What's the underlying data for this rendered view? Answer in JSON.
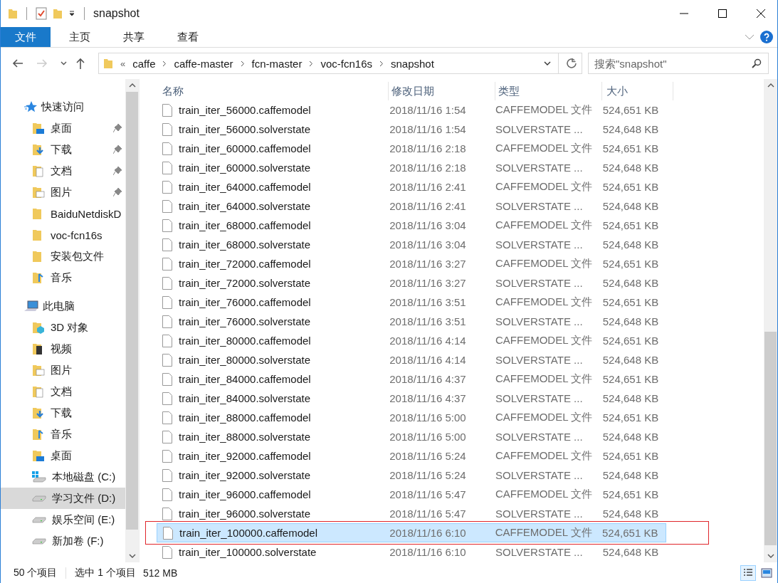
{
  "window": {
    "title": "snapshot"
  },
  "ribbon_tabs": [
    {
      "label": "文件",
      "selected": true
    },
    {
      "label": "主页",
      "selected": false
    },
    {
      "label": "共享",
      "selected": false
    },
    {
      "label": "查看",
      "selected": false
    }
  ],
  "address": {
    "overflow": "«",
    "path": [
      "caffe",
      "caffe-master",
      "fcn-master",
      "voc-fcn16s",
      "snapshot"
    ]
  },
  "search": {
    "placeholder": "搜索\"snapshot\""
  },
  "sidebar": {
    "items": [
      {
        "label": "快速访问",
        "kind": "star",
        "selected": false,
        "children": [
          {
            "label": "桌面",
            "kind": "desktop",
            "pinned": true,
            "selected": false
          },
          {
            "label": "下载",
            "kind": "download",
            "pinned": true,
            "selected": false
          },
          {
            "label": "文档",
            "kind": "documents",
            "pinned": true,
            "selected": false
          },
          {
            "label": "图片",
            "kind": "pictures",
            "pinned": true,
            "selected": false
          },
          {
            "label": "BaiduNetdiskD",
            "kind": "folder",
            "pinned": false,
            "selected": false
          },
          {
            "label": "voc-fcn16s",
            "kind": "folder",
            "pinned": false,
            "selected": false
          },
          {
            "label": "安装包文件",
            "kind": "folder",
            "pinned": false,
            "selected": false
          },
          {
            "label": "音乐",
            "kind": "music",
            "pinned": false,
            "selected": false
          }
        ]
      },
      {
        "label": "此电脑",
        "kind": "computer",
        "selected": false,
        "children": [
          {
            "label": "3D 对象",
            "kind": "objects3d",
            "pinned": false,
            "selected": false
          },
          {
            "label": "视频",
            "kind": "video",
            "pinned": false,
            "selected": false
          },
          {
            "label": "图片",
            "kind": "pictures",
            "pinned": false,
            "selected": false
          },
          {
            "label": "文档",
            "kind": "documents",
            "pinned": false,
            "selected": false
          },
          {
            "label": "下载",
            "kind": "download",
            "pinned": false,
            "selected": false
          },
          {
            "label": "音乐",
            "kind": "music",
            "pinned": false,
            "selected": false
          },
          {
            "label": "桌面",
            "kind": "desktop",
            "pinned": false,
            "selected": false
          },
          {
            "label": "本地磁盘 (C:)",
            "kind": "system-drive",
            "pinned": false,
            "selected": false
          },
          {
            "label": "学习文件 (D:)",
            "kind": "drive",
            "pinned": false,
            "selected": true
          },
          {
            "label": "娱乐空间 (E:)",
            "kind": "drive",
            "pinned": false,
            "selected": false
          },
          {
            "label": "新加卷 (F:)",
            "kind": "drive",
            "pinned": false,
            "selected": false
          }
        ]
      }
    ]
  },
  "table": {
    "columns": [
      "名称",
      "修改日期",
      "类型",
      "大小"
    ],
    "rows": [
      {
        "name": "train_iter_56000.caffemodel",
        "date": "2018/11/16 1:54",
        "type": "CAFFEMODEL 文件",
        "size": "524,651 KB",
        "selected": false,
        "boxed": false
      },
      {
        "name": "train_iter_56000.solverstate",
        "date": "2018/11/16 1:54",
        "type": "SOLVERSTATE ...",
        "size": "524,648 KB",
        "selected": false,
        "boxed": false
      },
      {
        "name": "train_iter_60000.caffemodel",
        "date": "2018/11/16 2:18",
        "type": "CAFFEMODEL 文件",
        "size": "524,651 KB",
        "selected": false,
        "boxed": false
      },
      {
        "name": "train_iter_60000.solverstate",
        "date": "2018/11/16 2:18",
        "type": "SOLVERSTATE ...",
        "size": "524,648 KB",
        "selected": false,
        "boxed": false
      },
      {
        "name": "train_iter_64000.caffemodel",
        "date": "2018/11/16 2:41",
        "type": "CAFFEMODEL 文件",
        "size": "524,651 KB",
        "selected": false,
        "boxed": false
      },
      {
        "name": "train_iter_64000.solverstate",
        "date": "2018/11/16 2:41",
        "type": "SOLVERSTATE ...",
        "size": "524,648 KB",
        "selected": false,
        "boxed": false
      },
      {
        "name": "train_iter_68000.caffemodel",
        "date": "2018/11/16 3:04",
        "type": "CAFFEMODEL 文件",
        "size": "524,651 KB",
        "selected": false,
        "boxed": false
      },
      {
        "name": "train_iter_68000.solverstate",
        "date": "2018/11/16 3:04",
        "type": "SOLVERSTATE ...",
        "size": "524,648 KB",
        "selected": false,
        "boxed": false
      },
      {
        "name": "train_iter_72000.caffemodel",
        "date": "2018/11/16 3:27",
        "type": "CAFFEMODEL 文件",
        "size": "524,651 KB",
        "selected": false,
        "boxed": false
      },
      {
        "name": "train_iter_72000.solverstate",
        "date": "2018/11/16 3:27",
        "type": "SOLVERSTATE ...",
        "size": "524,648 KB",
        "selected": false,
        "boxed": false
      },
      {
        "name": "train_iter_76000.caffemodel",
        "date": "2018/11/16 3:51",
        "type": "CAFFEMODEL 文件",
        "size": "524,651 KB",
        "selected": false,
        "boxed": false
      },
      {
        "name": "train_iter_76000.solverstate",
        "date": "2018/11/16 3:51",
        "type": "SOLVERSTATE ...",
        "size": "524,648 KB",
        "selected": false,
        "boxed": false
      },
      {
        "name": "train_iter_80000.caffemodel",
        "date": "2018/11/16 4:14",
        "type": "CAFFEMODEL 文件",
        "size": "524,651 KB",
        "selected": false,
        "boxed": false
      },
      {
        "name": "train_iter_80000.solverstate",
        "date": "2018/11/16 4:14",
        "type": "SOLVERSTATE ...",
        "size": "524,648 KB",
        "selected": false,
        "boxed": false
      },
      {
        "name": "train_iter_84000.caffemodel",
        "date": "2018/11/16 4:37",
        "type": "CAFFEMODEL 文件",
        "size": "524,651 KB",
        "selected": false,
        "boxed": false
      },
      {
        "name": "train_iter_84000.solverstate",
        "date": "2018/11/16 4:37",
        "type": "SOLVERSTATE ...",
        "size": "524,648 KB",
        "selected": false,
        "boxed": false
      },
      {
        "name": "train_iter_88000.caffemodel",
        "date": "2018/11/16 5:00",
        "type": "CAFFEMODEL 文件",
        "size": "524,651 KB",
        "selected": false,
        "boxed": false
      },
      {
        "name": "train_iter_88000.solverstate",
        "date": "2018/11/16 5:00",
        "type": "SOLVERSTATE ...",
        "size": "524,648 KB",
        "selected": false,
        "boxed": false
      },
      {
        "name": "train_iter_92000.caffemodel",
        "date": "2018/11/16 5:24",
        "type": "CAFFEMODEL 文件",
        "size": "524,651 KB",
        "selected": false,
        "boxed": false
      },
      {
        "name": "train_iter_92000.solverstate",
        "date": "2018/11/16 5:24",
        "type": "SOLVERSTATE ...",
        "size": "524,648 KB",
        "selected": false,
        "boxed": false
      },
      {
        "name": "train_iter_96000.caffemodel",
        "date": "2018/11/16 5:47",
        "type": "CAFFEMODEL 文件",
        "size": "524,651 KB",
        "selected": false,
        "boxed": false
      },
      {
        "name": "train_iter_96000.solverstate",
        "date": "2018/11/16 5:47",
        "type": "SOLVERSTATE ...",
        "size": "524,648 KB",
        "selected": false,
        "boxed": false
      },
      {
        "name": "train_iter_100000.caffemodel",
        "date": "2018/11/16 6:10",
        "type": "CAFFEMODEL 文件",
        "size": "524,651 KB",
        "selected": true,
        "boxed": true
      },
      {
        "name": "train_iter_100000.solverstate",
        "date": "2018/11/16 6:10",
        "type": "SOLVERSTATE ...",
        "size": "524,648 KB",
        "selected": false,
        "boxed": false
      }
    ]
  },
  "status_bar": {
    "count": "50 个项目",
    "selection": "选中 1 个项目",
    "size": "512 MB"
  }
}
